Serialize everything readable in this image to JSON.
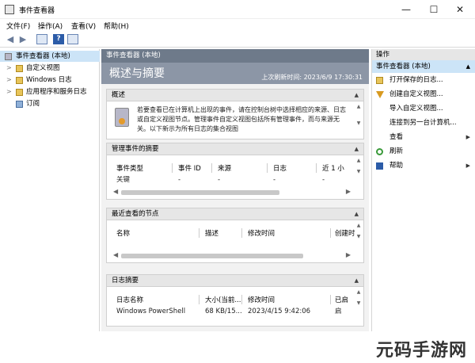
{
  "window": {
    "title": "事件查看器",
    "controls": {
      "minimize": "—",
      "maximize": "☐",
      "close": "✕"
    }
  },
  "menu": [
    {
      "label": "文件(F)"
    },
    {
      "label": "操作(A)"
    },
    {
      "label": "查看(V)"
    },
    {
      "label": "帮助(H)"
    }
  ],
  "tree": {
    "items": [
      {
        "label": "事件查看器 (本地)",
        "arrow": "",
        "selected": true
      },
      {
        "label": "自定义视图",
        "arrow": ">"
      },
      {
        "label": "Windows 日志",
        "arrow": ">"
      },
      {
        "label": "应用程序和服务日志",
        "arrow": ">"
      },
      {
        "label": "订阅",
        "arrow": ""
      }
    ]
  },
  "center": {
    "header": "事件查看器 (本地)",
    "banner_title": "概述与摘要",
    "last_refresh": "上次刷新时间: 2023/6/9 17:30:31",
    "overview": {
      "title": "概述",
      "text": "若要查看已在计算机上出现的事件，请在控制台树中选择相应的来源、日志或自定义视图节点。管理事件自定义视图包括所有管理事件，而与来源无关。以下新示为所有日志的集合视图"
    },
    "summary": {
      "title": "管理事件的摘要",
      "columns": [
        "事件类型",
        "事件 ID",
        "来源",
        "日志",
        "近 1 小"
      ],
      "row": [
        "关键",
        "-",
        "-",
        "-",
        "-"
      ]
    },
    "recent": {
      "title": "最近查看的节点",
      "columns": [
        "名称",
        "描述",
        "修改时间",
        "创建时"
      ]
    },
    "logsummary": {
      "title": "日志摘要",
      "columns": [
        "日志名称",
        "大小(当前...",
        "修改时间",
        "已启"
      ],
      "row": [
        "Windows PowerShell",
        "68 KB/15...",
        "2023/4/15 9:42:06",
        "启"
      ]
    }
  },
  "actions": {
    "header": "操作",
    "sub": "事件查看器 (本地)",
    "items": [
      {
        "label": "打开保存的日志...",
        "icon": "open-log-icon"
      },
      {
        "label": "创建自定义视图...",
        "icon": "filter-icon"
      },
      {
        "label": "导入自定义视图...",
        "icon": ""
      },
      {
        "label": "连接到另一台计算机...",
        "icon": ""
      },
      {
        "label": "查看",
        "icon": "",
        "more": "▶"
      },
      {
        "label": "刷新",
        "icon": "refresh-icon"
      },
      {
        "label": "帮助",
        "icon": "help-icon",
        "more": "▶"
      }
    ]
  },
  "watermark": "元码手游网"
}
